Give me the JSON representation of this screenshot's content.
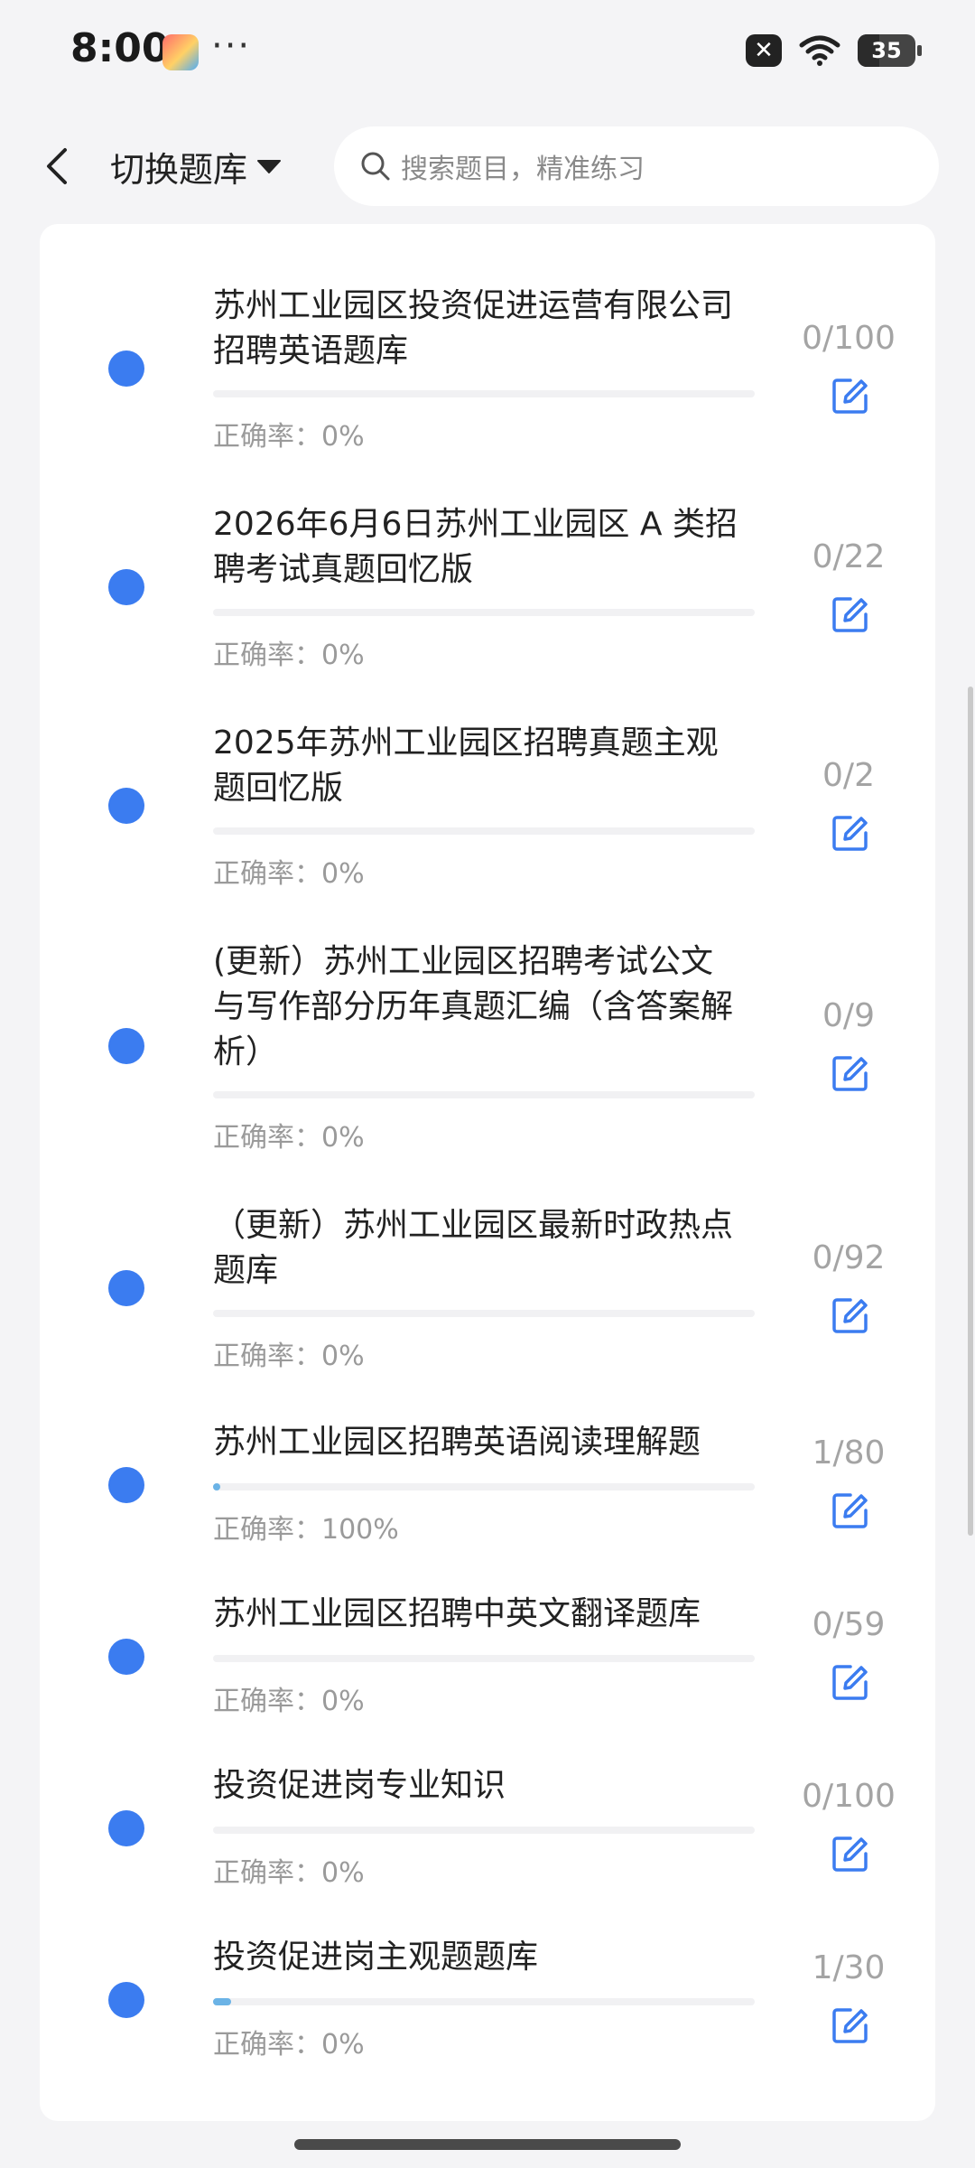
{
  "status_bar": {
    "time": "8:00",
    "more": "···",
    "battery_level": "35"
  },
  "header": {
    "switch_label": "切换题库",
    "search_placeholder": "搜索题目，精准练习"
  },
  "accuracy_prefix": "正确率：",
  "items": [
    {
      "title": "苏州工业园区投资促进运营有限公司招聘英语题库",
      "count": "0/100",
      "accuracy": "0%",
      "progress": 0
    },
    {
      "title": "2026年6月6日苏州工业园区 A 类招聘考试真题回忆版",
      "count": "0/22",
      "accuracy": "0%",
      "progress": 0
    },
    {
      "title": "2025年苏州工业园区招聘真题主观题回忆版",
      "count": "0/2",
      "accuracy": "0%",
      "progress": 0
    },
    {
      "title": "(更新）苏州工业园区招聘考试公文与写作部分历年真题汇编（含答案解析）",
      "count": "0/9",
      "accuracy": "0%",
      "progress": 0
    },
    {
      "title": "（更新）苏州工业园区最新时政热点题库",
      "count": "0/92",
      "accuracy": "0%",
      "progress": 0
    },
    {
      "title": "苏州工业园区招聘英语阅读理解题",
      "count": "1/80",
      "accuracy": "100%",
      "progress": 0.0125
    },
    {
      "title": "苏州工业园区招聘中英文翻译题库",
      "count": "0/59",
      "accuracy": "0%",
      "progress": 0
    },
    {
      "title": "投资促进岗专业知识",
      "count": "0/100",
      "accuracy": "0%",
      "progress": 0
    },
    {
      "title": "投资促进岗主观题题库",
      "count": "1/30",
      "accuracy": "0%",
      "progress": 0.033
    }
  ],
  "colors": {
    "dot": "#3b7cf0",
    "edit_icon": "#3b7cf0",
    "progress_fill": "#6bb3e6"
  }
}
